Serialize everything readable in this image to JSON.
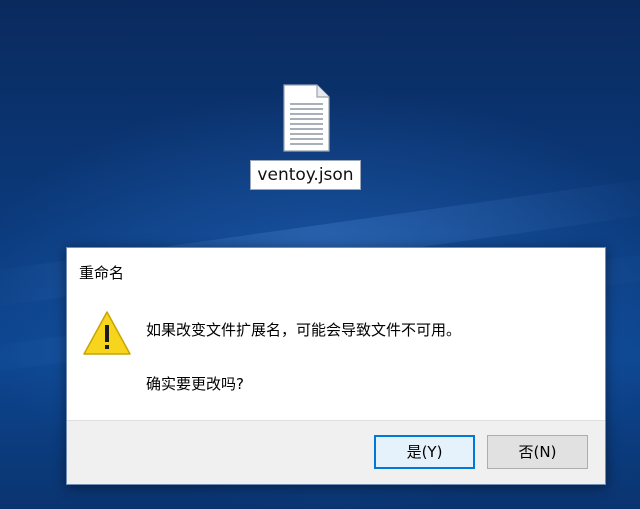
{
  "desktop": {
    "file_name": "ventoy.json",
    "file_icon": "text-document-icon"
  },
  "dialog": {
    "title": "重命名",
    "icon": "warning-icon",
    "message": "如果改变文件扩展名，可能会导致文件不可用。",
    "question": "确实要更改吗?",
    "buttons": {
      "yes": "是(Y)",
      "no": "否(N)"
    }
  },
  "colors": {
    "desktop_bg": "#0b3a7c",
    "dialog_bg": "#ffffff",
    "footer_bg": "#f0f0f0",
    "default_button_border": "#0078d7",
    "warning_fill": "#f7d51d"
  }
}
